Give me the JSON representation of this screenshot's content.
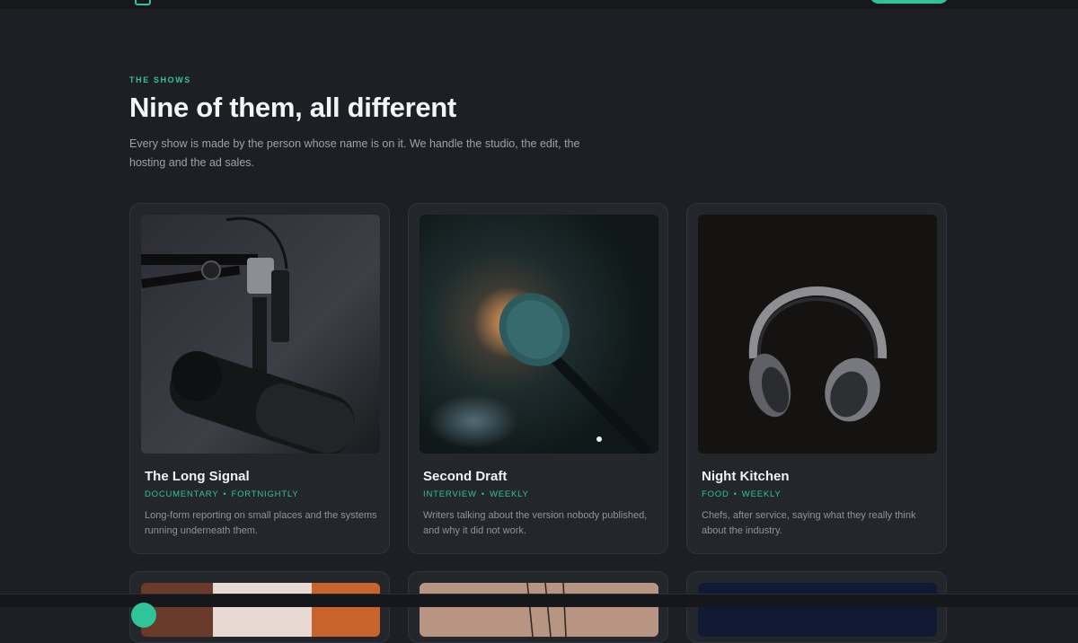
{
  "section": {
    "eyebrow": "THE SHOWS",
    "heading": "Nine of them, all different",
    "lede": "Every show is made by the person whose name is on it. We handle the studio, the edit, the hosting and the ad sales."
  },
  "shows": [
    {
      "title": "The Long Signal",
      "genre": "DOCUMENTARY",
      "cadence": "FORTNIGHTLY",
      "description": "Long-form reporting on small places and the systems running underneath them."
    },
    {
      "title": "Second Draft",
      "genre": "INTERVIEW",
      "cadence": "WEEKLY",
      "description": "Writers talking about the version nobody published, and why it did not work."
    },
    {
      "title": "Night Kitchen",
      "genre": "FOOD",
      "cadence": "WEEKLY",
      "description": "Chefs, after service, saying what they really think about the industry."
    }
  ],
  "meta_separator": "•",
  "colors": {
    "accent": "#2fc49a",
    "background": "#1d1f24",
    "card": "#23262b"
  }
}
